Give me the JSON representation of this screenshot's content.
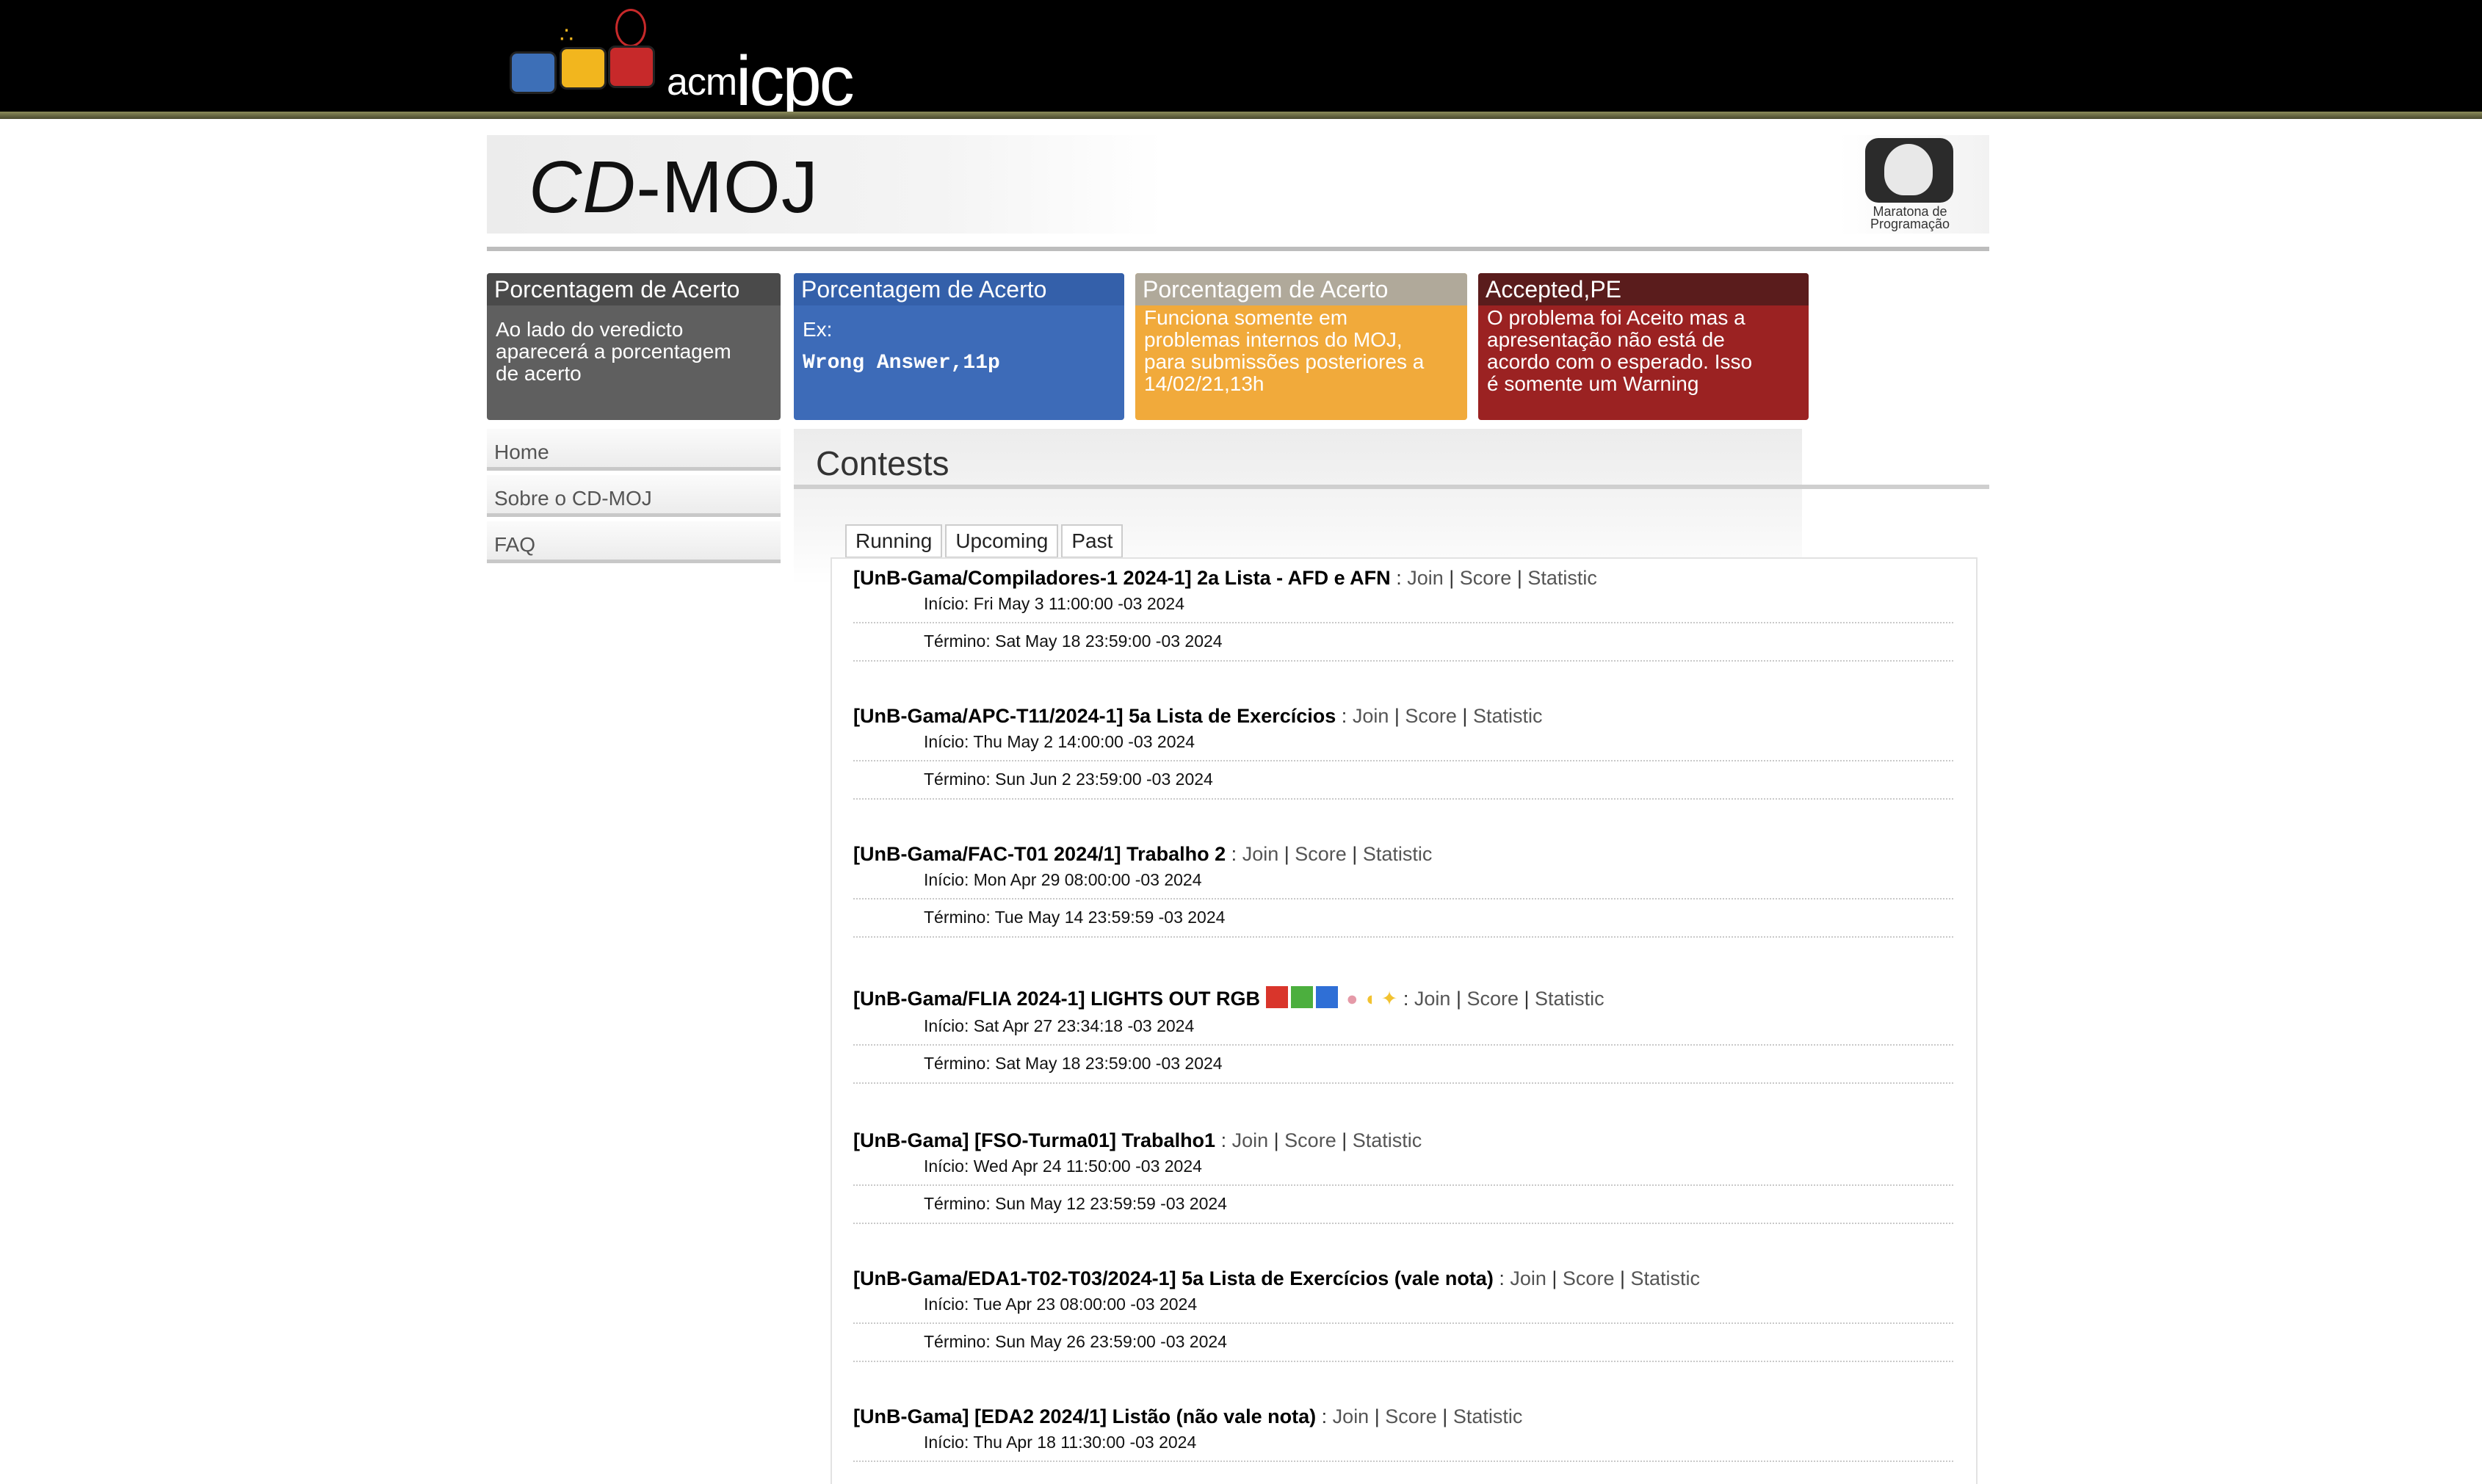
{
  "banner": {
    "acm_text": "acm",
    "icpc_text": "icpc"
  },
  "header": {
    "title_cd": "CD",
    "title_rest": "-MOJ",
    "logo_caption_1": "Maratona de",
    "logo_caption_2": "Programação"
  },
  "info_boxes": [
    {
      "title": "Porcentagem de Acerto",
      "lines": [
        "Ao lado do veredicto",
        "aparecerá a porcentagem",
        "de acerto"
      ]
    },
    {
      "title": "Porcentagem de Acerto",
      "lines": [
        "Ex:"
      ],
      "code": "Wrong Answer,11p"
    },
    {
      "title": "Porcentagem de Acerto",
      "lines": [
        "Funciona somente em",
        "problemas internos do MOJ,",
        "para submissões posteriores a",
        "14/02/21,13h"
      ]
    },
    {
      "title": "Accepted,PE",
      "lines": [
        "O problema foi Aceito mas a",
        "apresentação não está de",
        "acordo com o esperado. Isso",
        "é somente um Warning"
      ]
    }
  ],
  "nav": [
    "Home",
    "Sobre o CD-MOJ",
    "FAQ"
  ],
  "contests_title": "Contests",
  "tabs": [
    "Running",
    "Upcoming",
    "Past"
  ],
  "link_labels": {
    "join": "Join",
    "score": "Score",
    "statistic": "Statistic"
  },
  "contests": [
    {
      "name": "[UnB-Gama/Compiladores-1 2024-1] 2a Lista - AFD e AFN",
      "start": "Início: Fri May 3 11:00:00 -03 2024",
      "end": "Término: Sat May 18 23:59:00 -03 2024"
    },
    {
      "name": "[UnB-Gama/APC-T11/2024-1] 5a Lista de Exercícios",
      "start": "Início: Thu May 2 14:00:00 -03 2024",
      "end": "Término: Sun Jun 2 23:59:00 -03 2024"
    },
    {
      "name": "[UnB-Gama/FAC-T01 2024/1] Trabalho 2",
      "start": "Início: Mon Apr 29 08:00:00 -03 2024",
      "end": "Término: Tue May 14 23:59:59 -03 2024"
    },
    {
      "name": "[UnB-Gama/FLIA 2024-1] LIGHTS OUT RGB",
      "start": "Início: Sat Apr 27 23:34:18 -03 2024",
      "end": "Término: Sat May 18 23:59:00 -03 2024"
    },
    {
      "name": "[UnB-Gama] [FSO-Turma01] Trabalho1",
      "start": "Início: Wed Apr 24 11:50:00 -03 2024",
      "end": "Término: Sun May 12 23:59:59 -03 2024"
    },
    {
      "name": "[UnB-Gama/EDA1-T02-T03/2024-1] 5a Lista de Exercícios (vale nota)",
      "start": "Início: Tue Apr 23 08:00:00 -03 2024",
      "end": "Término: Sun May 26 23:59:00 -03 2024"
    },
    {
      "name": "[UnB-Gama] [EDA2 2024/1] Listão (não vale nota)",
      "start": "Início: Thu Apr 18 11:30:00 -03 2024",
      "end": ""
    }
  ]
}
